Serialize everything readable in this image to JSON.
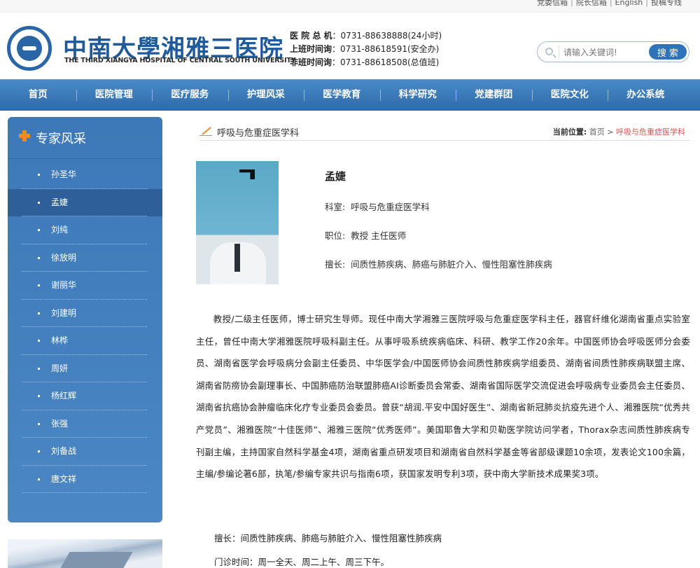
{
  "toplinks": [
    "党委信箱",
    "院长信箱",
    "English",
    "投稿专线"
  ],
  "header": {
    "logo_cn": "中南大學湘雅三医院",
    "logo_en": "THE THIRD XIANGYA HOSPITAL OF CENTRAL SOUTH UNIVERSITY",
    "phones": [
      {
        "label": "医 院 总 机",
        "value": "：0731-88638888(24小时)"
      },
      {
        "label": "上班时间询",
        "value": "：0731-88618591(安全办)"
      },
      {
        "label": "非班时间询",
        "value": "：0731-88618508(总值班)"
      }
    ]
  },
  "search": {
    "placeholder": "请输入关键词!",
    "button": "搜 索"
  },
  "nav": [
    "首页",
    "医院管理",
    "医疗服务",
    "护理风采",
    "医学教育",
    "科学研究",
    "党建群团",
    "医院文化",
    "办公系统"
  ],
  "sidebar": {
    "title": "专家风采",
    "items": [
      "孙圣华",
      "孟婕",
      "刘纯",
      "徐放明",
      "谢丽华",
      "刘建明",
      "林桦",
      "周妍",
      "杨红辉",
      "张强",
      "刘备战",
      "唐文祥"
    ],
    "active_index": 1
  },
  "content": {
    "dept_title": "呼吸与危重症医学科",
    "breadcrumb": {
      "label": "当前位置:",
      "home": "首页",
      "sep": ">",
      "current": "呼吸与危重症医学科"
    },
    "doctor": {
      "name": "孟婕",
      "dept_label": "科室:",
      "dept": "呼吸与危重症医学科",
      "title_label": "职位:",
      "title": "教授 主任医师",
      "spec_label": "擅长:",
      "spec": "间质性肺疾病、肺癌与肺脏介入、慢性阻塞性肺疾病"
    },
    "bio": "教授/二级主任医师，博士研究生导师。现任中南大学湘雅三医院呼吸与危重症医学科主任，器官纤维化湖南省重点实验室主任，曾任中南大学湘雅医院呼吸科副主任。从事呼吸系统疾病临床、科研、教学工作20余年。中国医师协会呼吸医师分会委员、湖南省医学会呼吸病分会副主任委员、中华医学会/中国医师协会间质性肺疾病学组委员、湖南省间质性肺疾病联盟主席、湖南省防痨协会副理事长、中国肺癌防治联盟肺癌AI诊断委员会常委、湖南省国际医学交流促进会呼吸病专业委员会主任委员、湖南省抗癌协会肿瘤临床化疗专业委员会委员。曾获“胡润.平安中国好医生”、湖南省新冠肺炎抗疫先进个人、湘雅医院“优秀共产党员”、湘雅医院“十佳医师”、湘雅三医院“优秀医师”。美国耶鲁大学和贝勒医学院访问学者，Thorax杂志间质性肺疾病专刊副主编，主持国家自然科学基金4项，湖南省重点研发项目和湖南省自然科学基金等省部级课题10余项，发表论文100余篇，主编/参编论著6部，执笔/参编专家共识与指南6项，获国家发明专利3项，获中南大学新技术成果奖3项。",
    "extra_spec": "擅长：间质性肺疾病、肺癌与肺脏介入、慢性阻塞性肺疾病",
    "clinic_time": "门诊时间：周一全天、周二上午、周三下午。"
  }
}
